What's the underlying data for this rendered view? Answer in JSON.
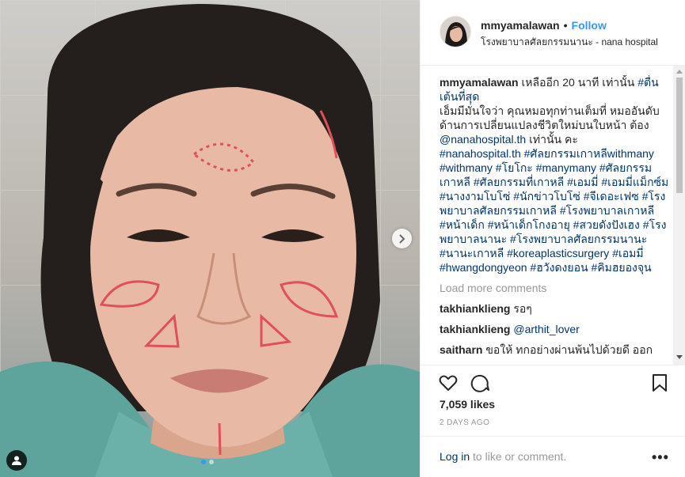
{
  "post": {
    "username": "mmyamalawan",
    "follow_separator": "•",
    "follow_label": "Follow",
    "location": "โรงพยาบาลศัลยกรรมนานะ - nana hospital"
  },
  "caption": {
    "username": "mmyamalawan",
    "p1": "เหลืออีก 20 นาที เท่านั้น ",
    "t1": "#ตื่นเต้นที่สุด",
    "p2": "เอ็มมีมั่นใจว่า คุณหมอทุกท่านเต็มที่ หมออันดับด้านการเปลี่ยนแปลงชีวิตใหม่บนใบหน้า ต้อง ",
    "t2": "@nanahospital.th",
    "p3": " เท่านั้น คะ",
    "t3": "#nanahospital.th #ศัลยกรรมเกาหลีwithmany #withmany #โยโกะ #manymany #ศัลยกรรมเกาหลี #ศัลยกรรมที่เกาหลี #เอมมี่ #เอมมี่แม็กซ์ม #นางงามโบโซ่ #นักข่าวโบโซ่ #จีเดอะเฟซ #โรงพยาบาลศัลยกรรมเกาหลี #โรงพยาบาลเกาหลี #หน้าเด็ก #หน้าเด็กโกงอายุ #สวยดังปังเฮง #โรงพยาบาลนานะ #โรงพยาบาลศัลยกรรมนานะ #นานะเกาหลี #koreaplasticsurgery #เอมมี่ #hwangdongyeon #ฮวังดงยอน #คิมฮยองจุน"
  },
  "load_more": "Load more comments",
  "comments": [
    {
      "user": "takhianklieng",
      "text": " รอๆ",
      "tag": ""
    },
    {
      "user": "takhianklieng",
      "text": " ",
      "tag": "@arthit_lover"
    },
    {
      "user": "saitharn",
      "text": " ขอให้ ทกอย่างผ่านพ้นไปด้วยดี ออก",
      "tag": ""
    }
  ],
  "likes": "7,059 likes",
  "time_ago": "2 DAYS AGO",
  "footer": {
    "login_link": "Log in",
    "login_rest": " to like or comment.",
    "more_label": "•••"
  },
  "carousel": {
    "index": 1,
    "count": 2
  },
  "colors": {
    "link": "#003569",
    "accent": "#3897f0",
    "muted": "#999999"
  },
  "icons": [
    "chevron-right-icon",
    "user-tag-icon",
    "heart-icon",
    "comment-icon",
    "bookmark-icon",
    "more-icon"
  ]
}
